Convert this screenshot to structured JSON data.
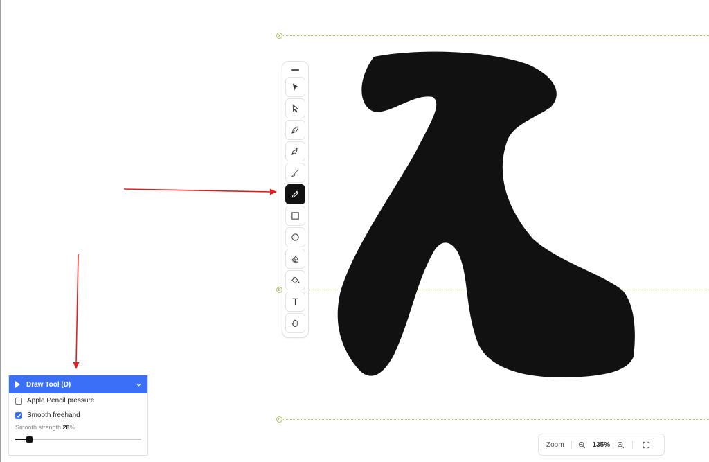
{
  "guides": [
    {
      "marker": "x",
      "name": "guide-x"
    },
    {
      "marker": "b",
      "name": "guide-b"
    },
    {
      "marker": "d",
      "name": "guide-d"
    }
  ],
  "toolbar": {
    "tools": [
      {
        "name": "select-tool",
        "icon": "arrow-filled-icon"
      },
      {
        "name": "direct-select-tool",
        "icon": "arrow-outline-icon"
      },
      {
        "name": "pen-tool",
        "icon": "pen-nib-icon"
      },
      {
        "name": "pen-plus-tool",
        "icon": "pen-plus-icon"
      },
      {
        "name": "brush-tool",
        "icon": "brush-icon"
      },
      {
        "name": "draw-tool",
        "icon": "pencil-icon",
        "active": true
      },
      {
        "name": "rectangle-tool",
        "icon": "square-icon"
      },
      {
        "name": "ellipse-tool",
        "icon": "circle-icon"
      },
      {
        "name": "eraser-tool",
        "icon": "eraser-icon"
      },
      {
        "name": "fill-tool",
        "icon": "paint-bucket-icon"
      },
      {
        "name": "text-tool",
        "icon": "text-icon"
      },
      {
        "name": "hand-tool",
        "icon": "hand-icon"
      }
    ]
  },
  "panel": {
    "title": "Draw Tool (D)",
    "options": [
      {
        "label": "Apple Pencil pressure",
        "checked": false
      },
      {
        "label": "Smooth freehand",
        "checked": true
      }
    ],
    "strength_label": "Smooth strength",
    "strength_value": "28",
    "strength_unit": "%",
    "strength_fraction": 0.11
  },
  "zoom": {
    "label": "Zoom",
    "value": "135%"
  },
  "colors": {
    "accent": "#3b6ff5",
    "glyph": "#111111",
    "guide": "#a9c35a",
    "arrow": "#e02020"
  }
}
